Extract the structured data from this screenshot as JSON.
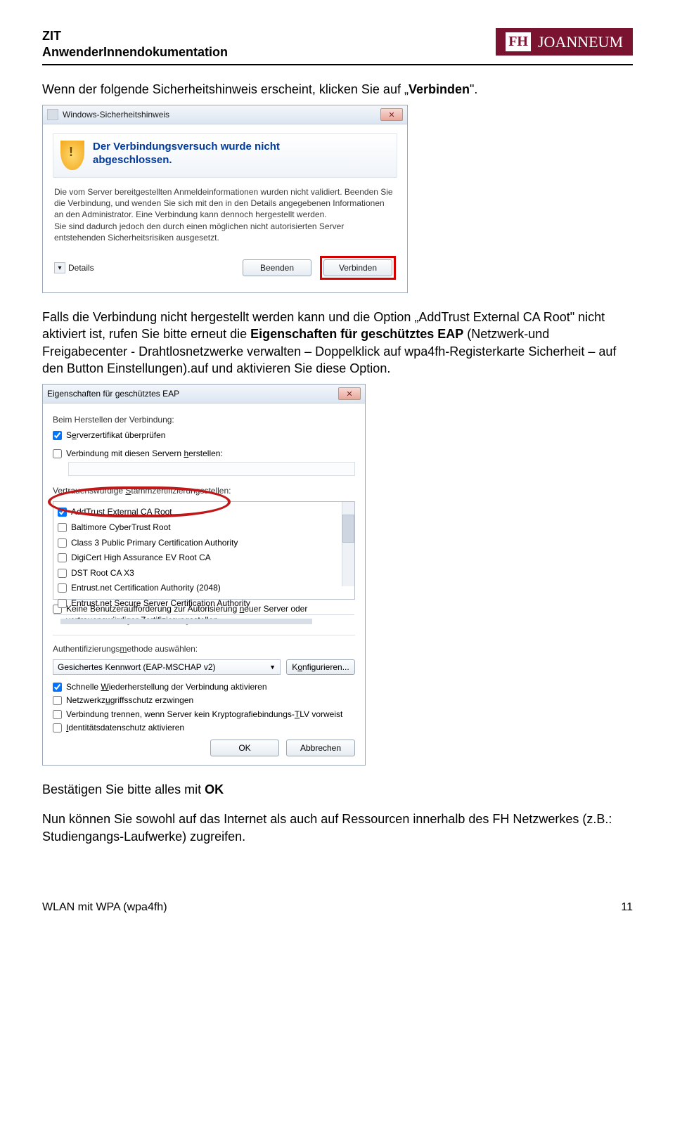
{
  "header": {
    "line1": "ZIT",
    "line2": "AnwenderInnendokumentation",
    "logo_fh": "FH",
    "logo_brand": "JOANNEUM"
  },
  "intro": {
    "pre": "Wenn der folgende Sicherheitshinweis erscheint, klicken Sie auf „",
    "bold": "Verbinden",
    "post": "\"."
  },
  "dlg1": {
    "title": "Windows-Sicherheitshinweis",
    "banner1": "Der Verbindungsversuch wurde nicht",
    "banner2": "abgeschlossen.",
    "info": "Die vom Server bereitgestellten Anmeldeinformationen wurden nicht validiert. Beenden Sie die Verbindung, und wenden Sie sich mit den in den Details angegebenen Informationen an den Administrator. Eine Verbindung kann dennoch hergestellt werden.\nSie sind dadurch jedoch den durch einen möglichen nicht autorisierten Server entstehenden Sicherheitsrisiken ausgesetzt.",
    "details": "Details",
    "beenden": "Beenden",
    "verbinden": "Verbinden"
  },
  "mid": {
    "p1a": "Falls die Verbindung nicht hergestellt werden kann und die Option „AddTrust External CA Root\" nicht aktiviert ist, rufen Sie bitte erneut die ",
    "p1b": "Eigenschaften für geschütztes EAP",
    "p1c": " (Netzwerk-und Freigabecenter - Drahtlosnetzwerke verwalten – Doppelklick auf wpa4fh-Registerkarte Sicherheit – auf den Button Einstellungen).auf und aktivieren Sie diese Option."
  },
  "dlg2": {
    "title": "Eigenschaften für geschütztes EAP",
    "sec1": "Beim Herstellen der Verbindung:",
    "srvcert_pre": "S",
    "srvcert_u": "e",
    "srvcert_post": "rverzertifikat überprüfen",
    "verbmit_pre": "Verbindung mit diesen Servern ",
    "verbmit_u": "h",
    "verbmit_post": "erstellen:",
    "stamm_pre": "Vertrauenswürdige ",
    "stamm_u": "S",
    "stamm_post": "tammzertifizierungsstellen:",
    "cas": [
      "AddTrust External CA Root",
      "Baltimore CyberTrust Root",
      "Class 3 Public Primary Certification Authority",
      "DigiCert High Assurance EV Root CA",
      "DST Root CA X3",
      "Entrust.net Certification Authority (2048)",
      "Entrust.net Secure Server Certification Authority"
    ],
    "noprompt_pre": "Keine Benutzeraufforderung zur Autorisierung ",
    "noprompt_u": "n",
    "noprompt_post": "euer Server oder vertrauenswürdiger Zertifizierungsstellen",
    "authlabel_pre": "Authentifizierungs",
    "authlabel_u": "m",
    "authlabel_post": "ethode auswählen:",
    "authval": "Gesichertes Kennwort (EAP-MSCHAP v2)",
    "konf_pre": "K",
    "konf_u": "o",
    "konf_post": "nfigurieren...",
    "fast_pre": "Schnelle ",
    "fast_u": "W",
    "fast_post": "iederherstellung der Verbindung aktivieren",
    "nap_pre": "Netzwerkz",
    "nap_u": "u",
    "nap_post": "griffsschutz erzwingen",
    "crypto_pre": "Verbindung trennen, wenn Server kein Kryptografiebindungs-",
    "crypto_u": "T",
    "crypto_post": "LV vorweist",
    "ident_pre": "",
    "ident_u": "I",
    "ident_post": "dentitätsdatenschutz aktivieren",
    "ok": "OK",
    "cancel": "Abbrechen"
  },
  "out": {
    "confirm_pre": "Bestätigen Sie bitte alles mit ",
    "confirm_b": "OK",
    "final": "Nun können Sie sowohl auf das Internet als auch auf Ressourcen innerhalb des FH Netzwerkes (z.B.: Studiengangs-Laufwerke) zugreifen."
  },
  "footer": {
    "left": "WLAN mit WPA (wpa4fh)",
    "right": "11"
  }
}
